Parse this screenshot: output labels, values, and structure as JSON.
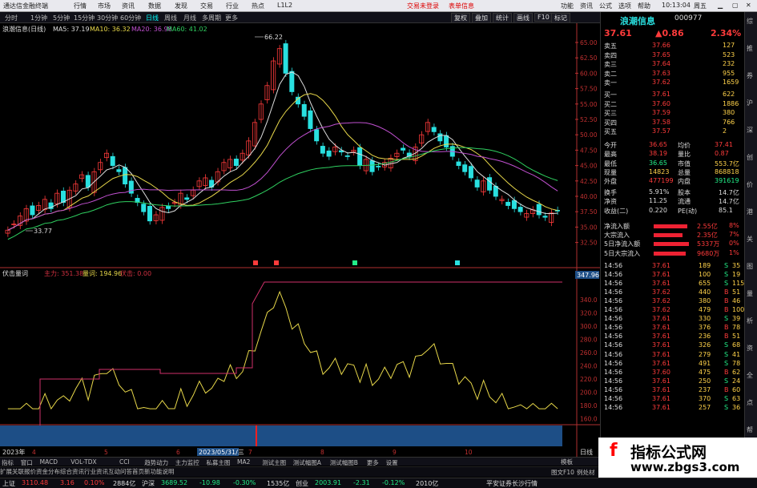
{
  "menu": {
    "app_title": "通达信金融终端",
    "items": [
      "行情",
      "市场",
      "资讯",
      "数据",
      "发现",
      "交易",
      "行业",
      "热点",
      "L1L2"
    ],
    "notice1": "交易未登录",
    "notice2": "表单信息",
    "right": [
      "功能",
      "资讯",
      "公式",
      "选项",
      "帮助"
    ],
    "clock": "10:13:04",
    "weekday": "周五"
  },
  "periods": [
    "分时",
    "1分钟",
    "5分钟",
    "15分钟",
    "30分钟",
    "60分钟",
    "日线",
    "周线",
    "月线",
    "多周期",
    "更多"
  ],
  "active_period": "日线",
  "tools": [
    "复权",
    "叠加",
    "统计",
    "画线",
    "F10",
    "标记"
  ],
  "ma_legend": {
    "title": "浪潮信息(日线)",
    "ma5": "MA5: 37.19",
    "ma10": "MA10: 36.32",
    "ma20": "MA20: 36.98",
    "ma60": "MA60: 41.02"
  },
  "price_axis": [
    "65.00",
    "62.50",
    "60.00",
    "57.50",
    "55.00",
    "52.50",
    "50.00",
    "47.50",
    "45.00",
    "42.50",
    "40.00",
    "37.50",
    "35.00",
    "32.50"
  ],
  "annotations": {
    "high": "66.22",
    "low": "33.77"
  },
  "indicator": {
    "title": "伏击量词",
    "l1": "主力: 351.38",
    "l2": "量词: 194.96",
    "l3": "伏击: 0.00",
    "cur": "347.96",
    "axis": [
      "340.0",
      "320.0",
      "300.0",
      "280.0",
      "260.0",
      "240.0",
      "220.0",
      "200.0",
      "180.0",
      "160.0"
    ]
  },
  "date_axis": {
    "year": "2023年",
    "sel": "2023/05/31/三",
    "marks": [
      "4",
      "5",
      "6",
      "7",
      "8",
      "9",
      "10"
    ],
    "right": "日线"
  },
  "stock": {
    "name": "浪潮信息",
    "code": "000977",
    "price": "37.61",
    "chg": "▲0.86",
    "pct": "2.34%"
  },
  "asks": [
    [
      "卖五",
      "37.66",
      "127"
    ],
    [
      "卖四",
      "37.65",
      "523"
    ],
    [
      "卖三",
      "37.64",
      "232"
    ],
    [
      "卖二",
      "37.63",
      "955"
    ],
    [
      "卖一",
      "37.62",
      "1659"
    ]
  ],
  "bids": [
    [
      "买一",
      "37.61",
      "622"
    ],
    [
      "买二",
      "37.60",
      "1886"
    ],
    [
      "买三",
      "37.59",
      "380"
    ],
    [
      "买四",
      "37.58",
      "766"
    ],
    [
      "买五",
      "37.57",
      "2"
    ]
  ],
  "stats": [
    [
      "今开",
      "36.65",
      "均价",
      "37.41"
    ],
    [
      "最高",
      "38.19",
      "量比",
      "0.87"
    ],
    [
      "最低",
      "36.65",
      "市值",
      "553.7亿"
    ],
    [
      "现量",
      "14823",
      "总量",
      "868818"
    ],
    [
      "外盘",
      "477199",
      "内盘",
      "391619"
    ]
  ],
  "stats2": [
    [
      "换手",
      "5.91%",
      "股本",
      "14.7亿"
    ],
    [
      "净资",
      "11.25",
      "流通",
      "14.7亿"
    ],
    [
      "收益(二)",
      "0.220",
      "PE(动)",
      "85.1"
    ]
  ],
  "flows": [
    [
      "净流入额",
      "2.55亿",
      "8%"
    ],
    [
      "大宗流入",
      "2.35亿",
      "7%"
    ],
    [
      "5日净流入额",
      "5337万",
      "0%"
    ],
    [
      "5日大宗流入",
      "9680万",
      "1%"
    ]
  ],
  "ticks": [
    [
      "14:56",
      "37.61",
      "189",
      "S",
      "35"
    ],
    [
      "14:56",
      "37.61",
      "100",
      "S",
      "19"
    ],
    [
      "14:56",
      "37.61",
      "655",
      "S",
      "115"
    ],
    [
      "14:56",
      "37.62",
      "440",
      "B",
      "51"
    ],
    [
      "14:56",
      "37.62",
      "380",
      "B",
      "46"
    ],
    [
      "14:56",
      "37.62",
      "479",
      "B",
      "100"
    ],
    [
      "14:56",
      "37.61",
      "330",
      "S",
      "39"
    ],
    [
      "14:56",
      "37.61",
      "376",
      "B",
      "78"
    ],
    [
      "14:56",
      "37.61",
      "236",
      "B",
      "51"
    ],
    [
      "14:56",
      "37.61",
      "326",
      "S",
      "68"
    ],
    [
      "14:56",
      "37.61",
      "279",
      "S",
      "41"
    ],
    [
      "14:56",
      "37.61",
      "491",
      "S",
      "78"
    ],
    [
      "14:56",
      "37.60",
      "475",
      "B",
      "62"
    ],
    [
      "14:56",
      "37.61",
      "250",
      "S",
      "24"
    ],
    [
      "14:56",
      "37.61",
      "237",
      "B",
      "60"
    ],
    [
      "14:56",
      "37.61",
      "370",
      "S",
      "63"
    ],
    [
      "14:56",
      "37.61",
      "257",
      "S",
      "36"
    ]
  ],
  "bottom_tabs": [
    "指标",
    "窗口",
    "MACD",
    "VOL-TDX",
    "CCI",
    "趋势动力",
    "主力监控",
    "私募主图",
    "MA2",
    "测试主图",
    "测试幅图A",
    "测试幅图B",
    "更多",
    "设置"
  ],
  "bottom_tabs2": [
    "扩展",
    "关联报价",
    "资金分布",
    "综合资讯",
    "行业资讯",
    "互动问答",
    "首页新功能说明"
  ],
  "bottom_right": [
    "模板",
    "图文F10",
    "例处材"
  ],
  "statusbar": [
    {
      "t": "上证",
      "c": "#ddd"
    },
    {
      "t": "3110.48",
      "c": "#ff3b3b"
    },
    {
      "t": "3.16",
      "c": "#ff3b3b"
    },
    {
      "t": "0.10%",
      "c": "#ff3b3b"
    },
    {
      "t": "2884亿",
      "c": "#ddd"
    },
    {
      "t": "沪深",
      "c": "#ddd"
    },
    {
      "t": "3689.52",
      "c": "#22ee88"
    },
    {
      "t": "-10.98",
      "c": "#22ee88"
    },
    {
      "t": "-0.30%",
      "c": "#22ee88"
    },
    {
      "t": "1535亿",
      "c": "#ddd"
    },
    {
      "t": "创业",
      "c": "#ddd"
    },
    {
      "t": "2003.91",
      "c": "#22ee88"
    },
    {
      "t": "-2.31",
      "c": "#22ee88"
    },
    {
      "t": "-0.12%",
      "c": "#22ee88"
    },
    {
      "t": "2010亿",
      "c": "#ddd"
    },
    {
      "t": "平安证券长沙行情",
      "c": "#ddd"
    }
  ],
  "watermark": {
    "t1": "指标公式网",
    "t2": "www.zbgs3.com"
  },
  "side_tabs": [
    "综",
    "推",
    "券",
    "沪",
    "深",
    "创",
    "价",
    "港",
    "关",
    "图",
    "量",
    "析",
    "资",
    "全",
    "点",
    "帮"
  ],
  "colors": {
    "up": "#ff3b3b",
    "down": "#22ee88",
    "accent": "#29e0e0"
  }
}
